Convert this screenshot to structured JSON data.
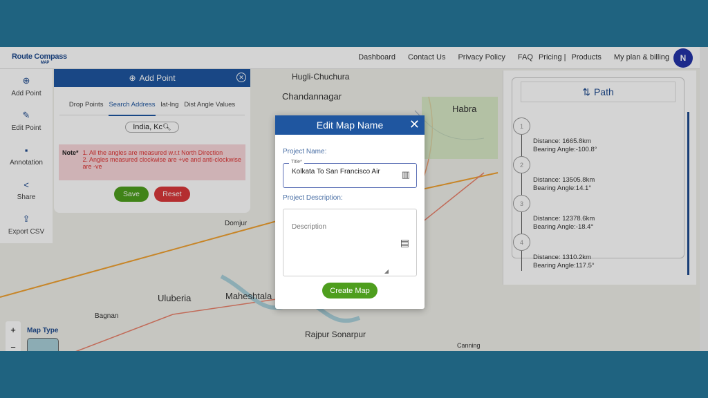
{
  "brand": {
    "name": "Route Compass",
    "sub": "MAP"
  },
  "nav": [
    "Dashboard",
    "Contact Us",
    "Privacy Policy",
    "FAQ",
    "Pricing |",
    "Products",
    "My plan & billing"
  ],
  "user_initial": "N",
  "sidebar": [
    {
      "label": "Add Point",
      "icon": "add-circle-icon"
    },
    {
      "label": "Edit Point",
      "icon": "pencil-icon"
    },
    {
      "label": "Annotation",
      "icon": "comment-icon"
    },
    {
      "label": "Share",
      "icon": "share-icon"
    },
    {
      "label": "Export CSV",
      "icon": "export-icon"
    }
  ],
  "add_point": {
    "title": "Add Point",
    "tabs": [
      "Drop Points",
      "Search Address",
      "lat-lng",
      "Dist Angle Values"
    ],
    "active_tab": "Search Address",
    "search_value": "India, Kc",
    "note_label": "Note*",
    "note_lines": [
      "1. All the angles are measured w.r.t North Direction",
      "2. Angles measured clockwise are +ve and anti-clockwise are -ve"
    ],
    "save": "Save",
    "reset": "Reset"
  },
  "map": {
    "places": [
      "Hugli-Chuchura",
      "Chandannagar",
      "Habra",
      "Domjur",
      "Maheshtala",
      "Uluberia",
      "Bagnan",
      "Rajpur Sonarpur",
      "Canning"
    ],
    "map_type_label": "Map Type",
    "zoom_in": "+",
    "zoom_out": "−"
  },
  "path": {
    "title": "Path",
    "steps": [
      {
        "n": "1",
        "distance": "Distance: 1665.8km",
        "bearing": "Bearing Angle:-100.8°"
      },
      {
        "n": "2",
        "distance": "Distance: 13505.8km",
        "bearing": "Bearing Angle:14.1°"
      },
      {
        "n": "3",
        "distance": "Distance: 12378.6km",
        "bearing": "Bearing Angle:-18.4°"
      },
      {
        "n": "4",
        "distance": "Distance: 1310.2km",
        "bearing": "Bearing Angle:117.5°"
      }
    ]
  },
  "modal": {
    "title": "Edit Map Name",
    "project_name_label": "Project Name:",
    "title_field_label": "Title*",
    "title_value": "Kolkata To San Francisco Air",
    "project_desc_label": "Project Description:",
    "desc_placeholder": "Description",
    "create": "Create Map"
  },
  "colors": {
    "primary": "#1f56a0",
    "save": "#4e9e1e",
    "reset": "#d9383a",
    "frame": "#1f6380"
  }
}
